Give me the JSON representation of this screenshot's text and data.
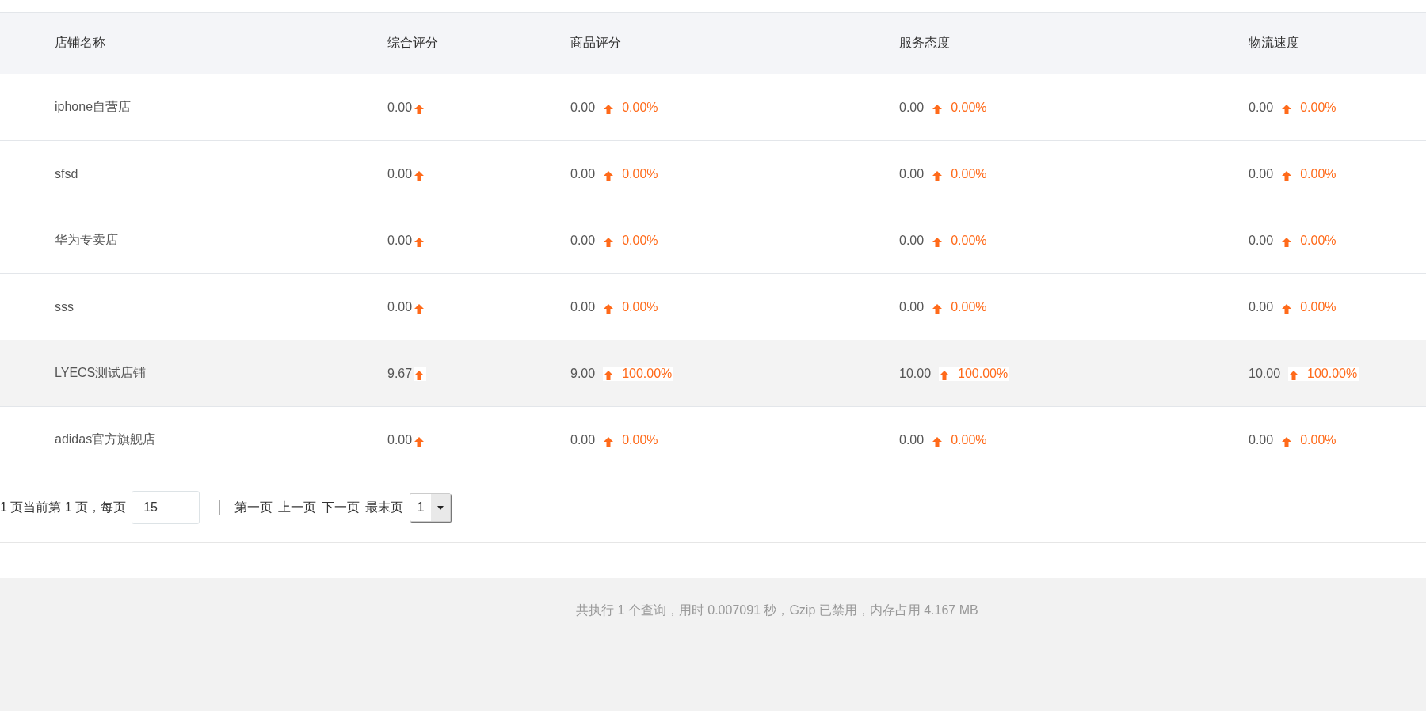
{
  "table": {
    "columns": [
      "店铺名称",
      "综合评分",
      "商品评分",
      "服务态度",
      "物流速度"
    ],
    "rows": [
      {
        "name": "iphone自营店",
        "highlighted": false,
        "scores": [
          {
            "value": "0.00"
          },
          {
            "value": "0.00",
            "change": "0.00%"
          },
          {
            "value": "0.00",
            "change": "0.00%"
          },
          {
            "value": "0.00",
            "change": "0.00%"
          }
        ]
      },
      {
        "name": "sfsd",
        "highlighted": false,
        "scores": [
          {
            "value": "0.00"
          },
          {
            "value": "0.00",
            "change": "0.00%"
          },
          {
            "value": "0.00",
            "change": "0.00%"
          },
          {
            "value": "0.00",
            "change": "0.00%"
          }
        ]
      },
      {
        "name": "华为专卖店",
        "highlighted": false,
        "scores": [
          {
            "value": "0.00"
          },
          {
            "value": "0.00",
            "change": "0.00%"
          },
          {
            "value": "0.00",
            "change": "0.00%"
          },
          {
            "value": "0.00",
            "change": "0.00%"
          }
        ]
      },
      {
        "name": "sss",
        "highlighted": false,
        "scores": [
          {
            "value": "0.00"
          },
          {
            "value": "0.00",
            "change": "0.00%"
          },
          {
            "value": "0.00",
            "change": "0.00%"
          },
          {
            "value": "0.00",
            "change": "0.00%"
          }
        ]
      },
      {
        "name": "LYECS测试店铺",
        "highlighted": true,
        "scores": [
          {
            "value": "9.67"
          },
          {
            "value": "9.00",
            "change": "100.00%"
          },
          {
            "value": "10.00",
            "change": "100.00%"
          },
          {
            "value": "10.00",
            "change": "100.00%"
          }
        ]
      },
      {
        "name": "adidas官方旗舰店",
        "highlighted": false,
        "scores": [
          {
            "value": "0.00"
          },
          {
            "value": "0.00",
            "change": "0.00%"
          },
          {
            "value": "0.00",
            "change": "0.00%"
          },
          {
            "value": "0.00",
            "change": "0.00%"
          }
        ]
      }
    ]
  },
  "pagination": {
    "summary": "1 页当前第 1 页，每页",
    "per_page": "15",
    "links": [
      "第一页",
      "上一页",
      "下一页",
      "最末页"
    ],
    "page_select": "1"
  },
  "footer": {
    "text": "共执行 1 个查询，用时 0.007091 秒，Gzip 已禁用，内存占用 4.167 MB"
  }
}
